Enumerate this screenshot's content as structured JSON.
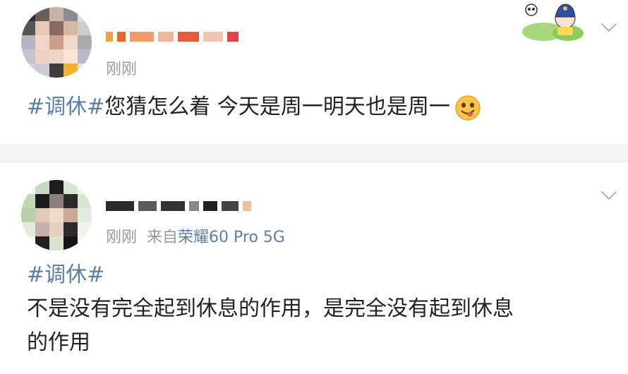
{
  "posts": [
    {
      "time": "刚刚",
      "hashtag": "#调休#",
      "text": "您猜怎么着 今天是周一明天也是周一",
      "emoji": "smirk-emoji"
    },
    {
      "time": "刚刚",
      "source_prefix": "来自",
      "source_device": "荣耀60 Pro 5G",
      "hashtag": "#调休#",
      "line1": "不是没有完全起到休息的作用，是完全没有起到休息",
      "line2": "的作用"
    }
  ],
  "colors": {
    "link": "#5b7fa6",
    "text": "#222222",
    "meta": "#999999",
    "divider": "#f4f4f4"
  },
  "icons": [
    "chevron-down-icon",
    "cartoon-sticker"
  ]
}
